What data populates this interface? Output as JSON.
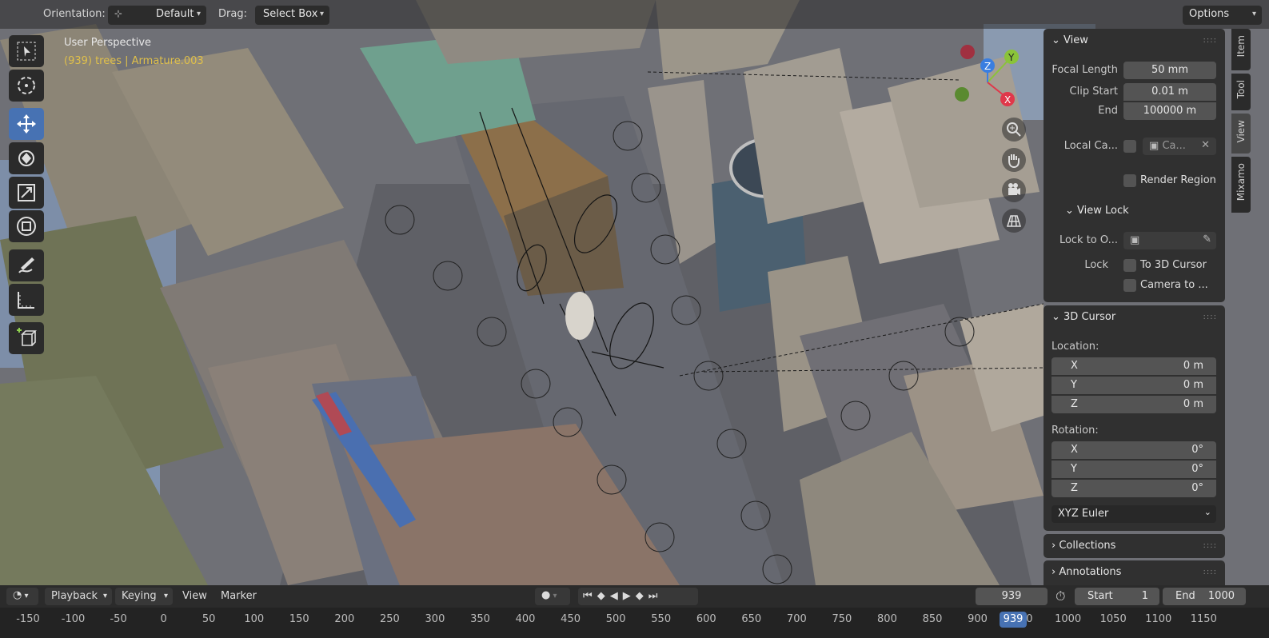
{
  "header": {
    "orientation_label": "Orientation:",
    "orientation_value": "Default",
    "drag_label": "Drag:",
    "drag_value": "Select Box",
    "options_label": "Options"
  },
  "viewport": {
    "title": "User Perspective",
    "subtitle": "(939) trees | Armature.003"
  },
  "toolbar": {
    "tools": [
      "select-box",
      "cursor",
      "move",
      "rotate",
      "scale",
      "transform",
      "annotate",
      "measure",
      "add-cube"
    ],
    "active_tool": "move"
  },
  "gizmo": {
    "axes": [
      "Z",
      "Y",
      "X"
    ]
  },
  "sidebar_tabs": [
    "Item",
    "Tool",
    "View",
    "Mixamo"
  ],
  "active_sidebar_tab": "View",
  "view_panel": {
    "title": "View",
    "focal_length_label": "Focal Length",
    "focal_length_value": "50 mm",
    "clip_start_label": "Clip Start",
    "clip_start_value": "0.01 m",
    "clip_end_label": "End",
    "clip_end_value": "100000 m",
    "local_camera_label": "Local Ca...",
    "local_camera_value": "Ca...",
    "render_region_label": "Render Region",
    "view_lock_title": "View Lock",
    "lock_to_object_label": "Lock to O...",
    "lock_label": "Lock",
    "to_3d_cursor_label": "To 3D Cursor",
    "camera_to_view_label": "Camera to ..."
  },
  "cursor_panel": {
    "title": "3D Cursor",
    "location_label": "Location:",
    "location": [
      {
        "axis": "X",
        "value": "0 m"
      },
      {
        "axis": "Y",
        "value": "0 m"
      },
      {
        "axis": "Z",
        "value": "0 m"
      }
    ],
    "rotation_label": "Rotation:",
    "rotation": [
      {
        "axis": "X",
        "value": "0°"
      },
      {
        "axis": "Y",
        "value": "0°"
      },
      {
        "axis": "Z",
        "value": "0°"
      }
    ],
    "rotation_mode": "XYZ Euler"
  },
  "collections_title": "Collections",
  "annotations_title": "Annotations",
  "timeline": {
    "playback_label": "Playback",
    "keying_label": "Keying",
    "view_label": "View",
    "marker_label": "Marker",
    "current_frame": "939",
    "start_label": "Start",
    "start_value": "1",
    "end_label": "End",
    "end_value": "1000"
  },
  "ruler": {
    "ticks": [
      "-150",
      "-100",
      "-50",
      "0",
      "50",
      "100",
      "150",
      "200",
      "250",
      "300",
      "350",
      "400",
      "450",
      "500",
      "550",
      "600",
      "650",
      "700",
      "750",
      "800",
      "850",
      "900",
      "950",
      "1000",
      "1050",
      "1100",
      "1150"
    ],
    "current_frame_badge": "939"
  },
  "colors": {
    "accent": "#4772b3",
    "viewport_subtitle": "#e0c04a",
    "axis_x": "#e0384a",
    "axis_y": "#8ac33a",
    "axis_z": "#3a7ee0"
  }
}
